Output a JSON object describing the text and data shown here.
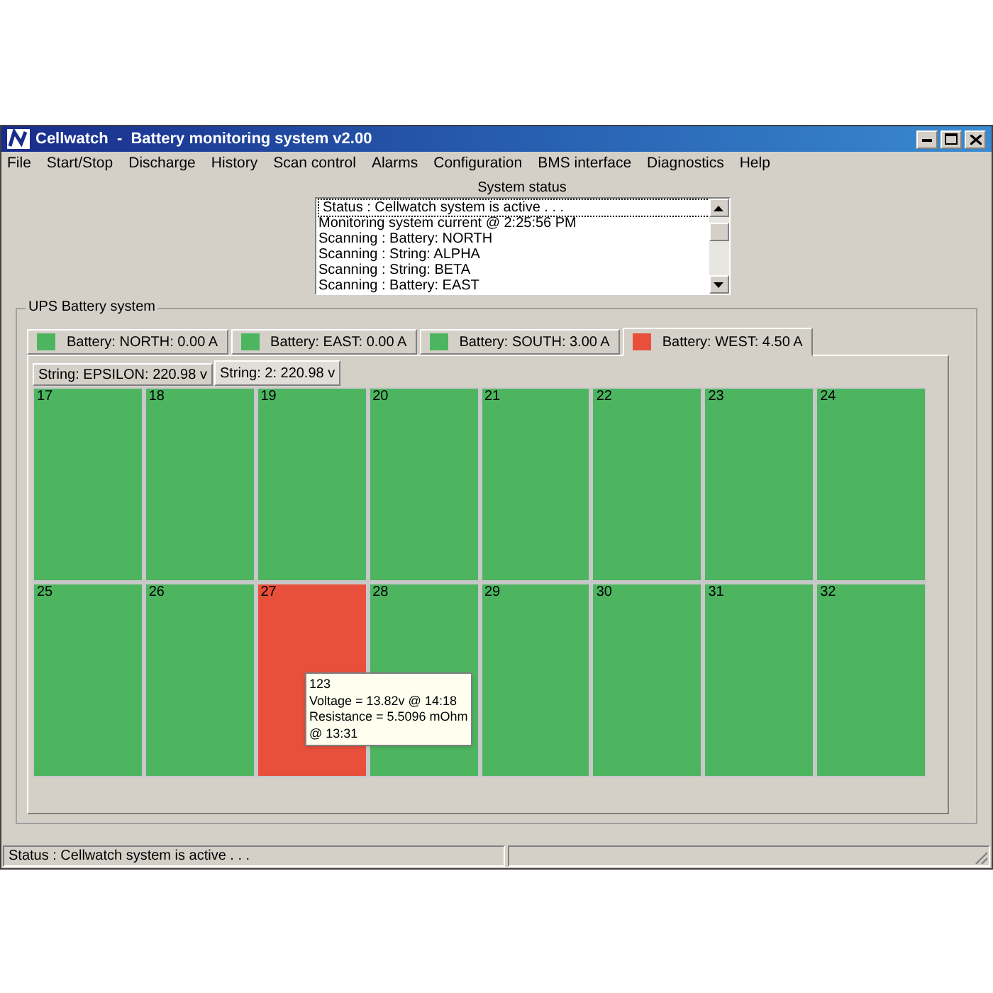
{
  "window": {
    "title": "Cellwatch  -  Battery monitoring system v2.00"
  },
  "menu": [
    "File",
    "Start/Stop",
    "Discharge",
    "History",
    "Scan control",
    "Alarms",
    "Configuration",
    "BMS interface",
    "Diagnostics",
    "Help"
  ],
  "system_status": {
    "label": "System status",
    "lines": [
      {
        "text": "Status : Cellwatch system is active . . .",
        "selected": true
      },
      {
        "text": "Monitoring system current @ 2:25:56 PM",
        "selected": false
      },
      {
        "text": "Scanning : Battery: NORTH",
        "selected": false
      },
      {
        "text": "Scanning : String: ALPHA",
        "selected": false
      },
      {
        "text": "Scanning : String: BETA",
        "selected": false
      },
      {
        "text": "Scanning : Battery: EAST",
        "selected": false
      }
    ]
  },
  "group": {
    "label": "UPS Battery system"
  },
  "battery_tabs": [
    {
      "label": "Battery: NORTH: 0.00 A",
      "color": "#4db560",
      "selected": false
    },
    {
      "label": "Battery: EAST: 0.00 A",
      "color": "#4db560",
      "selected": false
    },
    {
      "label": "Battery: SOUTH: 3.00 A",
      "color": "#4db560",
      "selected": false
    },
    {
      "label": "Battery: WEST: 4.50 A",
      "color": "#e8503c",
      "selected": true
    }
  ],
  "string_tabs": [
    {
      "label": "String: EPSILON: 220.98 v",
      "selected": false
    },
    {
      "label": "String: 2: 220.98 v",
      "selected": true
    }
  ],
  "cells": [
    {
      "label": "17",
      "color": "#4db560"
    },
    {
      "label": "18",
      "color": "#4db560"
    },
    {
      "label": "19",
      "color": "#4db560"
    },
    {
      "label": "20",
      "color": "#4db560"
    },
    {
      "label": "21",
      "color": "#4db560"
    },
    {
      "label": "22",
      "color": "#4db560"
    },
    {
      "label": "23",
      "color": "#4db560"
    },
    {
      "label": "24",
      "color": "#4db560"
    },
    {
      "label": "25",
      "color": "#4db560"
    },
    {
      "label": "26",
      "color": "#4db560"
    },
    {
      "label": "27",
      "color": "#e8503c"
    },
    {
      "label": "28",
      "color": "#4db560"
    },
    {
      "label": "29",
      "color": "#4db560"
    },
    {
      "label": "30",
      "color": "#4db560"
    },
    {
      "label": "31",
      "color": "#4db560"
    },
    {
      "label": "32",
      "color": "#4db560"
    }
  ],
  "tooltip": {
    "lines": [
      "123",
      "Voltage = 13.82v @ 14:18",
      "Resistance = 5.5096 mOhm",
      "@ 13:31"
    ]
  },
  "status_bar": {
    "text": "Status : Cellwatch system is active . . ."
  }
}
